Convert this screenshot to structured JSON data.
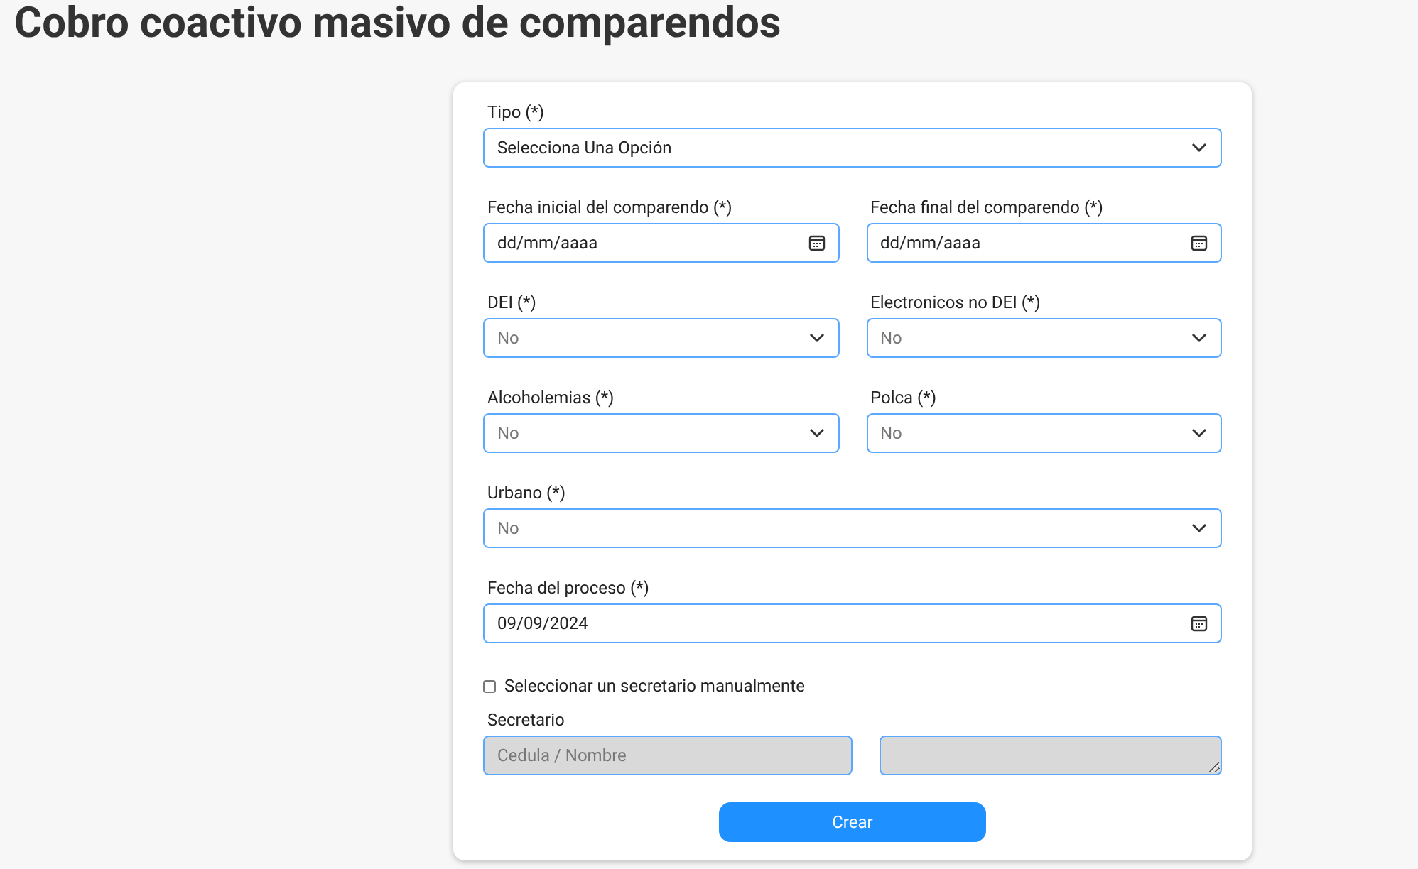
{
  "title": "Cobro coactivo masivo de comparendos",
  "rows": [
    [
      {
        "kind": "select",
        "label": "Tipo (*)",
        "value": "Selecciona Una Opción",
        "dimmed": false
      }
    ],
    [
      {
        "kind": "date",
        "label": "Fecha inicial del comparendo (*)",
        "placeholder": "dd/mm/aaaa"
      },
      {
        "kind": "date",
        "label": "Fecha final del comparendo (*)",
        "placeholder": "dd/mm/aaaa"
      }
    ],
    [
      {
        "kind": "select",
        "label": "DEI (*)",
        "value": "No",
        "dimmed": true
      },
      {
        "kind": "select",
        "label": "Electronicos no DEI (*)",
        "value": "No",
        "dimmed": true
      }
    ],
    [
      {
        "kind": "select",
        "label": "Alcoholemias (*)",
        "value": "No",
        "dimmed": true
      },
      {
        "kind": "select",
        "label": "Polca (*)",
        "value": "No",
        "dimmed": true
      }
    ],
    [
      {
        "kind": "select",
        "label": "Urbano (*)",
        "value": "No",
        "dimmed": true
      }
    ],
    [
      {
        "kind": "date",
        "label": "Fecha del proceso (*)",
        "value": "09/09/2024"
      }
    ]
  ],
  "manual_checkbox": {
    "label": "Seleccionar un secretario manualmente",
    "checked": false
  },
  "secretario": {
    "label": "Secretario",
    "search": {
      "placeholder": "Cedula / Nombre",
      "disabled": true
    },
    "detail": {
      "disabled": true
    }
  },
  "submit": "Crear"
}
